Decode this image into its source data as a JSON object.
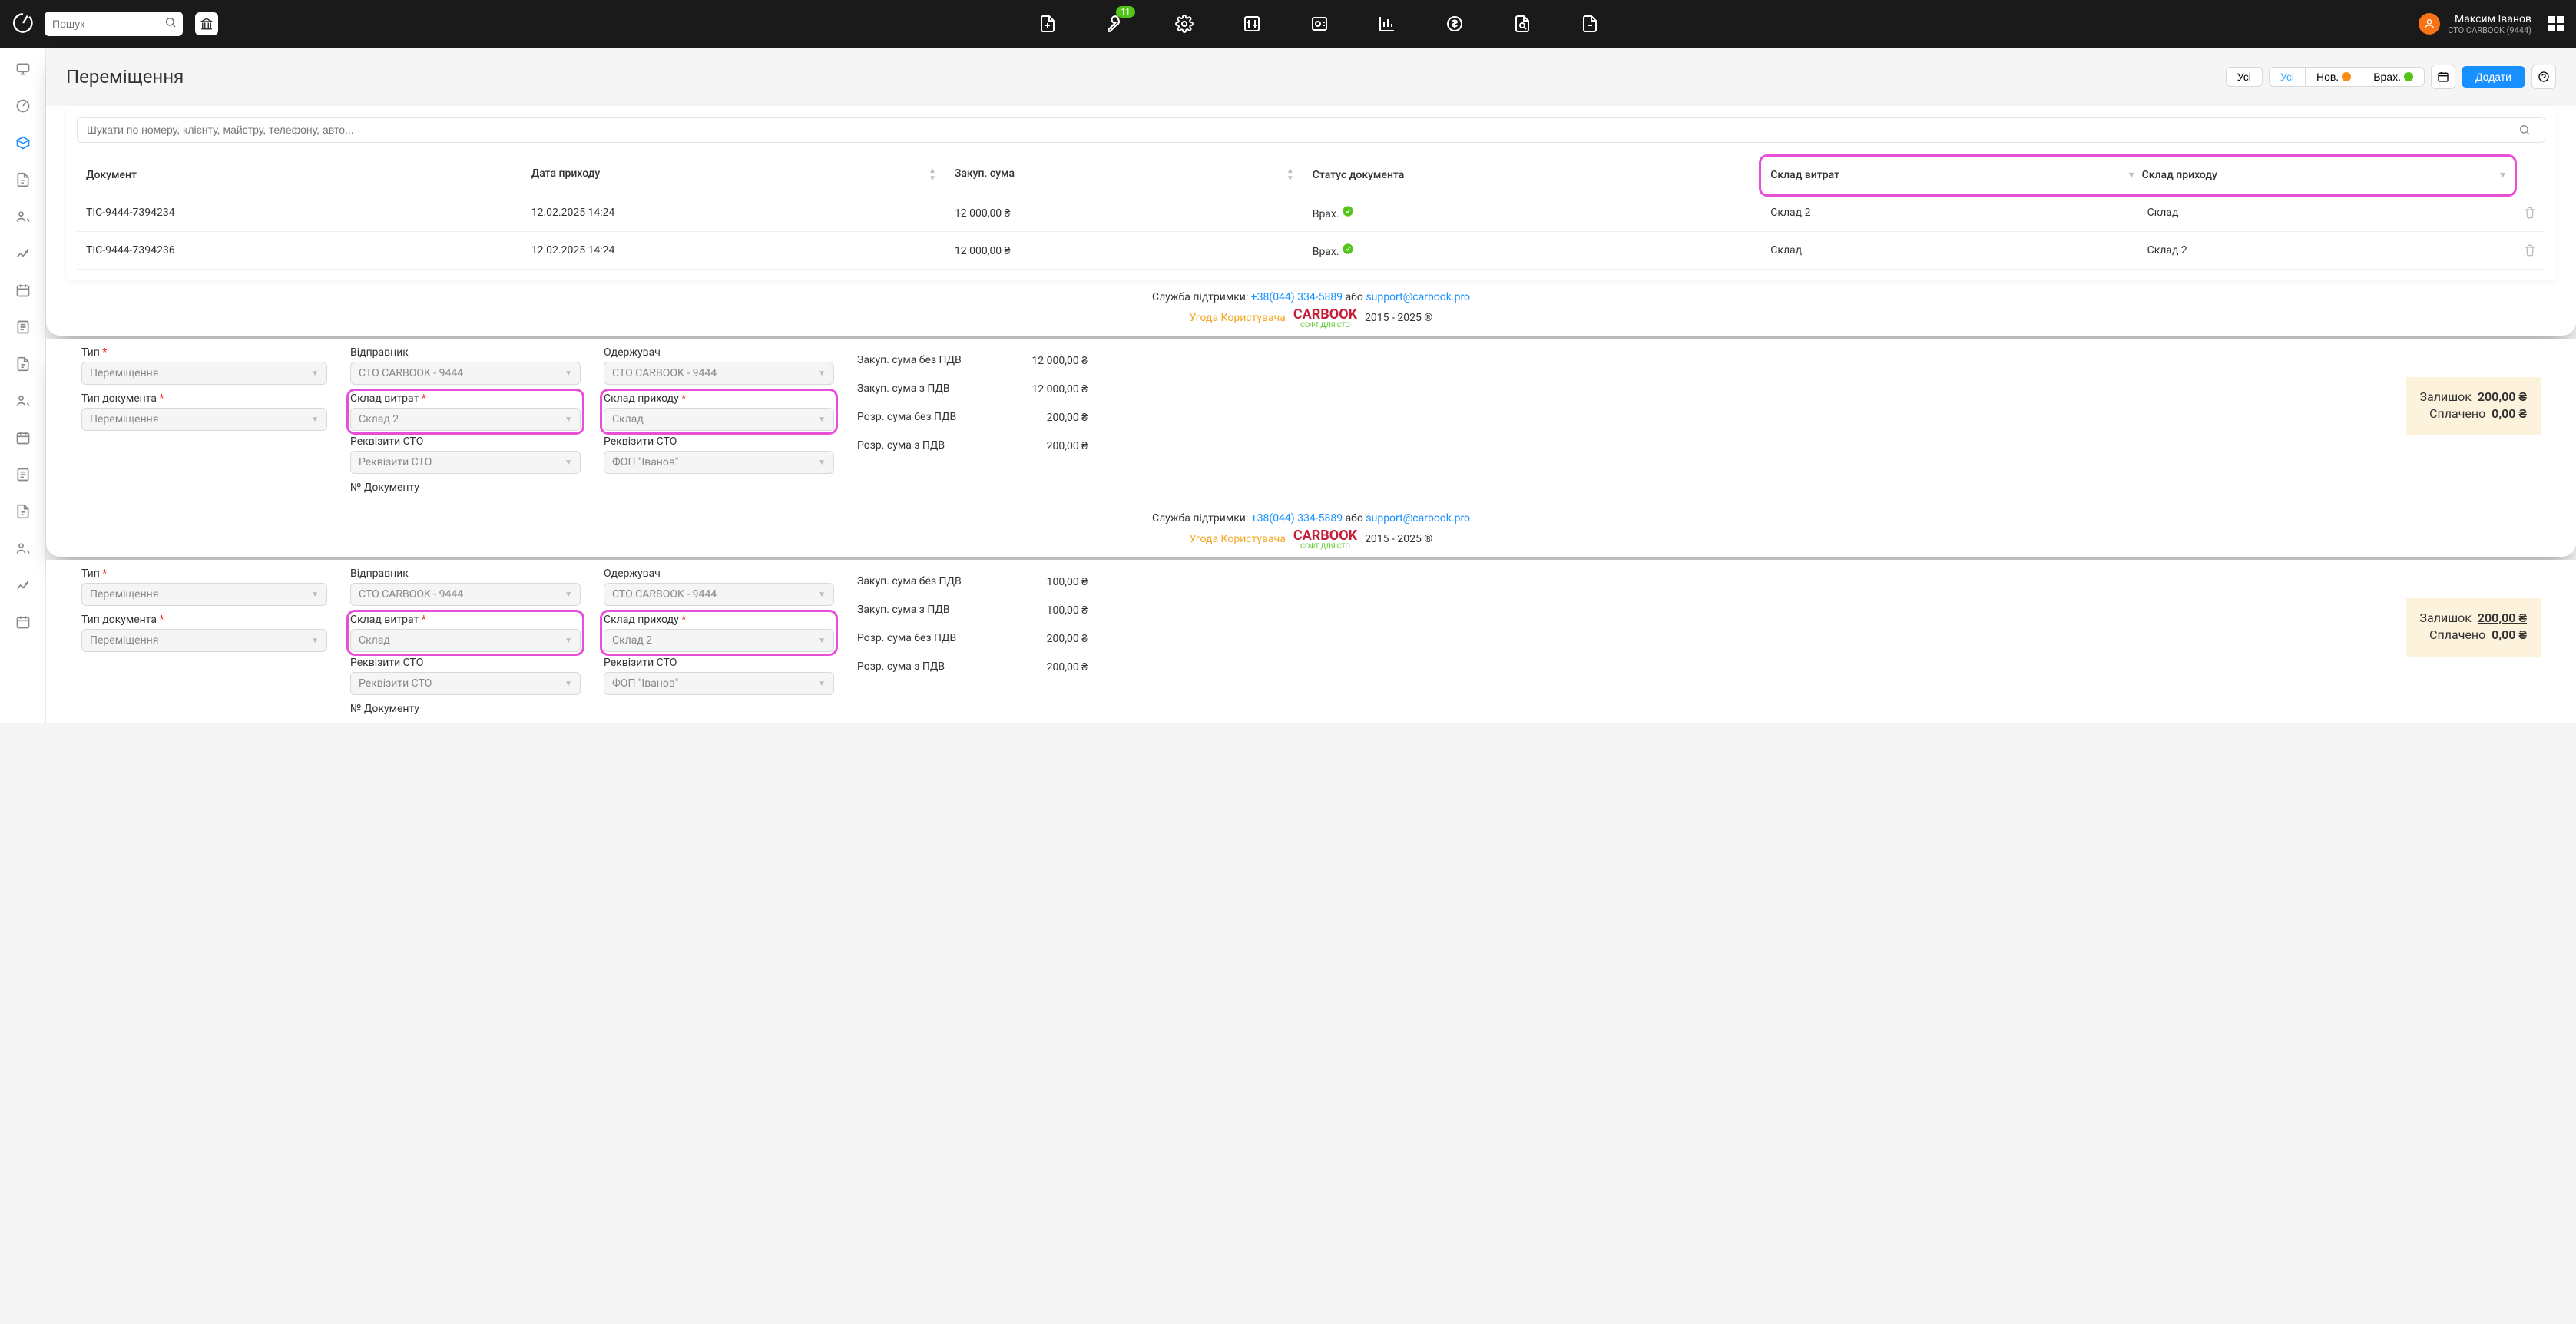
{
  "header": {
    "search_placeholder": "Пошук",
    "key_badge": "11",
    "user_name": "Максим Іванов",
    "user_org": "СТО CARBOOK (9444)"
  },
  "page": {
    "title": "Переміщення",
    "btn_all": "Усі",
    "btn_all2": "Усі",
    "btn_new": "Нов.",
    "btn_taken": "Врах.",
    "btn_add": "Додати"
  },
  "table": {
    "search_placeholder": "Шукати по номеру, клієнту, майстру, телефону, авто...",
    "cols": {
      "doc": "Документ",
      "date": "Дата приходу",
      "sum": "Закуп. сума",
      "status": "Статус документа",
      "ware_out": "Склад витрат",
      "ware_in": "Склад приходу"
    },
    "rows": [
      {
        "doc": "TIC-9444-7394234",
        "date": "12.02.2025 14:24",
        "sum": "12 000,00 ₴",
        "status": "Врах.",
        "ware_out": "Склад 2",
        "ware_in": "Склад"
      },
      {
        "doc": "TIC-9444-7394236",
        "date": "12.02.2025 14:24",
        "sum": "12 000,00 ₴",
        "status": "Врах.",
        "ware_out": "Склад",
        "ware_in": "Склад 2"
      }
    ]
  },
  "footer": {
    "support_label": "Служба підтримки: ",
    "phone": "+38(044) 334-5889",
    "or": " або ",
    "email": "support@carbook.pro",
    "agreement": "Угода Користувача",
    "brand": "CARBOOK",
    "brand_sub": "СОФТ ДЛЯ СТО",
    "years": "2015 - 2025 ®"
  },
  "form1": {
    "type_label": "Тип",
    "type_val": "Переміщення",
    "doctype_label": "Тип документа",
    "doctype_val": "Переміщення",
    "sender_label": "Відправник",
    "sender_val": "СТО CARBOOK - 9444",
    "receiver_label": "Одержувач",
    "receiver_val": "СТО CARBOOK - 9444",
    "ware_out_label": "Склад витрат",
    "ware_out_val": "Склад 2",
    "ware_in_label": "Склад приходу",
    "ware_in_val": "Склад",
    "req_label": "Реквізити СТО",
    "req_val": "Реквізити СТО",
    "req2_label": "Реквізити СТО",
    "req2_val": "ФОП \"Іванов\"",
    "docnum_label": "№ Документу",
    "sum1_label": "Закуп. сума без ПДВ",
    "sum1_val": "12 000,00 ₴",
    "sum2_label": "Закуп. сума з ПДВ",
    "sum2_val": "12 000,00 ₴",
    "sum3_label": "Розр. сума без ПДВ",
    "sum3_val": "200,00 ₴",
    "sum4_label": "Розр. сума з ПДВ",
    "sum4_val": "200,00 ₴",
    "balance_label": "Залишок",
    "balance_val": "200,00 ₴",
    "paid_label": "Сплачено",
    "paid_val": "0,00 ₴"
  },
  "form2": {
    "type_label": "Тип",
    "type_val": "Переміщення",
    "doctype_label": "Тип документа",
    "doctype_val": "Переміщення",
    "sender_label": "Відправник",
    "sender_val": "СТО CARBOOK - 9444",
    "receiver_label": "Одержувач",
    "receiver_val": "СТО CARBOOK - 9444",
    "ware_out_label": "Склад витрат",
    "ware_out_val": "Склад",
    "ware_in_label": "Склад приходу",
    "ware_in_val": "Склад 2",
    "req_label": "Реквізити СТО",
    "req_val": "Реквізити СТО",
    "req2_label": "Реквізити СТО",
    "req2_val": "ФОП \"Іванов\"",
    "docnum_label": "№ Документу",
    "sum1_label": "Закуп. сума без ПДВ",
    "sum1_val": "100,00 ₴",
    "sum2_label": "Закуп. сума з ПДВ",
    "sum2_val": "100,00 ₴",
    "sum3_label": "Розр. сума без ПДВ",
    "sum3_val": "200,00 ₴",
    "sum4_label": "Розр. сума з ПДВ",
    "sum4_val": "200,00 ₴",
    "balance_label": "Залишок",
    "balance_val": "200,00 ₴",
    "paid_label": "Сплачено",
    "paid_val": "0,00 ₴"
  }
}
